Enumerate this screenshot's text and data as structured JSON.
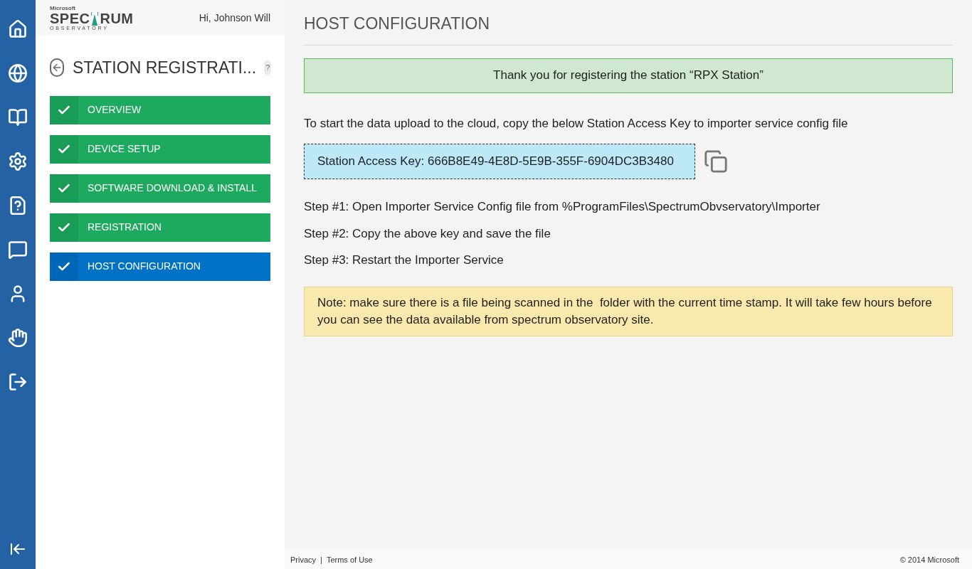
{
  "logo": {
    "brand": "Microsoft",
    "name_start": "SPEC",
    "name_end": "RUM",
    "subtitle": "OBSERVATORY"
  },
  "greeting": "Hi, Johnson Will",
  "wizard": {
    "title": "STATION REGISTRATI...",
    "help": "?",
    "steps": [
      {
        "label": "OVERVIEW",
        "completed": true,
        "selected": false
      },
      {
        "label": "DEVICE SETUP",
        "completed": true,
        "selected": false
      },
      {
        "label": "SOFTWARE DOWNLOAD & INSTALL",
        "completed": true,
        "selected": false
      },
      {
        "label": "REGISTRATION",
        "completed": true,
        "selected": false
      },
      {
        "label": "HOST CONFIGURATION",
        "completed": true,
        "selected": true
      }
    ]
  },
  "page_title": "HOST CONFIGURATION",
  "success_message": "Thank you for registering the station “RPX Station”",
  "instruction": "To start the data upload to the cloud, copy the below Station Access Key to importer service config file",
  "access_key": "Station Access Key: 666B8E49-4E8D-5E9B-355F-6904DC3B3480",
  "steps_text": [
    "Step #1: Open Importer Service Config file from %ProgramFiles\\SpectrumObvservatory\\Importer",
    "Step #2: Copy the above key and save the file",
    "Step #3: Restart the Importer Service"
  ],
  "note": "Note: make sure there is a file being scanned in the  folder with the current time stamp. It will take few hours before you can see the data available from spectrum observatory site.",
  "footer": {
    "links": [
      "Privacy",
      "Terms of Use"
    ],
    "separator": "|",
    "copyright": "© 2014 Microsoft"
  }
}
